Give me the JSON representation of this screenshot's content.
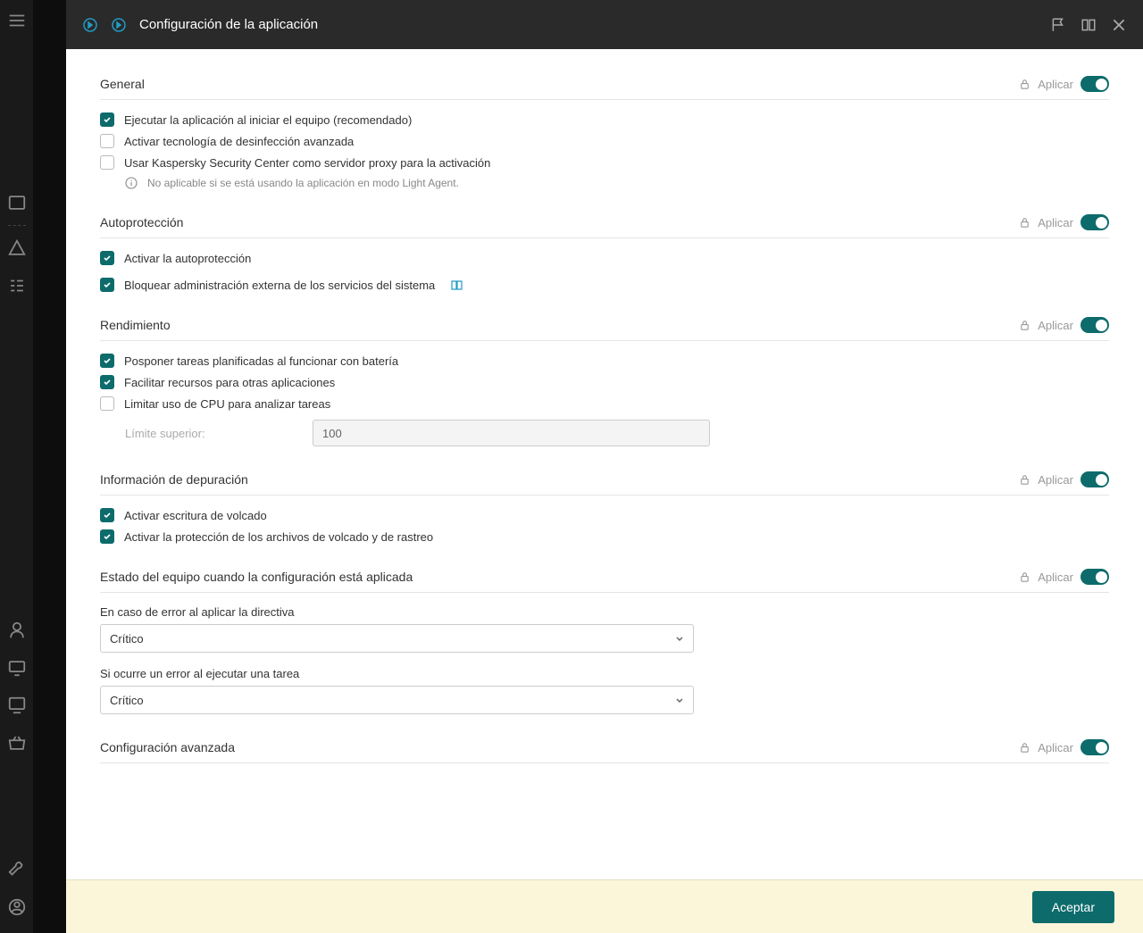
{
  "header": {
    "title": "Configuración de la aplicación"
  },
  "sections": {
    "general": {
      "title": "General",
      "apply": "Aplicar",
      "opt1": "Ejecutar la aplicación al iniciar el equipo (recomendado)",
      "opt2": "Activar tecnología de desinfección avanzada",
      "opt3": "Usar Kaspersky Security Center como servidor proxy para la activación",
      "info": "No aplicable si se está usando la aplicación en modo Light Agent."
    },
    "autoprotection": {
      "title": "Autoprotección",
      "apply": "Aplicar",
      "opt1": "Activar la autoprotección",
      "opt2": "Bloquear administración externa de los servicios del sistema"
    },
    "performance": {
      "title": "Rendimiento",
      "apply": "Aplicar",
      "opt1": "Posponer tareas planificadas al funcionar con batería",
      "opt2": "Facilitar recursos para otras aplicaciones",
      "opt3": "Limitar uso de CPU para analizar tareas",
      "limit_label": "Límite superior:",
      "limit_value": "100"
    },
    "debug": {
      "title": "Información de depuración",
      "apply": "Aplicar",
      "opt1": "Activar escritura de volcado",
      "opt2": "Activar la protección de los archivos de volcado y de rastreo"
    },
    "status": {
      "title": "Estado del equipo cuando la configuración está aplicada",
      "apply": "Aplicar",
      "label1": "En caso de error al aplicar la directiva",
      "value1": "Crítico",
      "label2": "Si ocurre un error al ejecutar una tarea",
      "value2": "Crítico"
    },
    "advanced": {
      "title": "Configuración avanzada",
      "apply": "Aplicar"
    }
  },
  "footer": {
    "accept": "Aceptar"
  }
}
